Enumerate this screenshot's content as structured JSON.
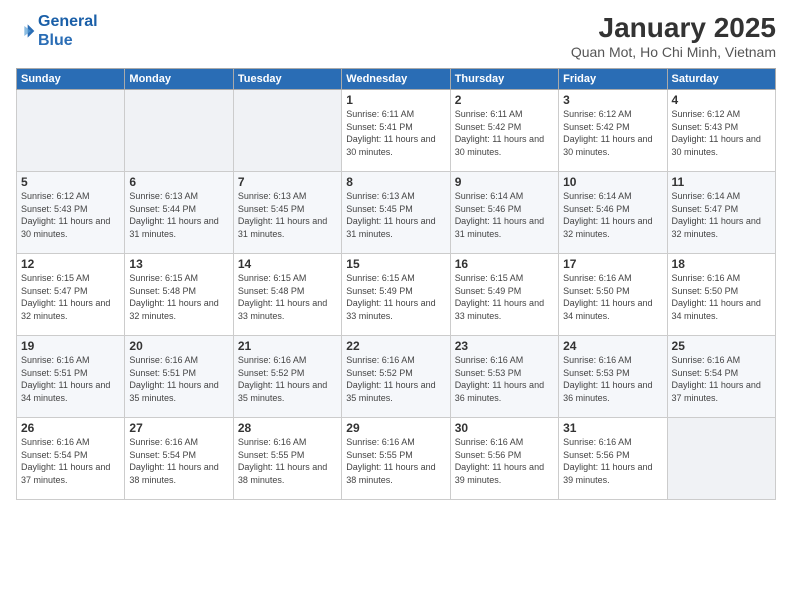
{
  "logo": {
    "line1": "General",
    "line2": "Blue"
  },
  "title": "January 2025",
  "subtitle": "Quan Mot, Ho Chi Minh, Vietnam",
  "weekdays": [
    "Sunday",
    "Monday",
    "Tuesday",
    "Wednesday",
    "Thursday",
    "Friday",
    "Saturday"
  ],
  "weeks": [
    [
      {
        "day": "",
        "info": ""
      },
      {
        "day": "",
        "info": ""
      },
      {
        "day": "",
        "info": ""
      },
      {
        "day": "1",
        "info": "Sunrise: 6:11 AM\nSunset: 5:41 PM\nDaylight: 11 hours\nand 30 minutes."
      },
      {
        "day": "2",
        "info": "Sunrise: 6:11 AM\nSunset: 5:42 PM\nDaylight: 11 hours\nand 30 minutes."
      },
      {
        "day": "3",
        "info": "Sunrise: 6:12 AM\nSunset: 5:42 PM\nDaylight: 11 hours\nand 30 minutes."
      },
      {
        "day": "4",
        "info": "Sunrise: 6:12 AM\nSunset: 5:43 PM\nDaylight: 11 hours\nand 30 minutes."
      }
    ],
    [
      {
        "day": "5",
        "info": "Sunrise: 6:12 AM\nSunset: 5:43 PM\nDaylight: 11 hours\nand 30 minutes."
      },
      {
        "day": "6",
        "info": "Sunrise: 6:13 AM\nSunset: 5:44 PM\nDaylight: 11 hours\nand 31 minutes."
      },
      {
        "day": "7",
        "info": "Sunrise: 6:13 AM\nSunset: 5:45 PM\nDaylight: 11 hours\nand 31 minutes."
      },
      {
        "day": "8",
        "info": "Sunrise: 6:13 AM\nSunset: 5:45 PM\nDaylight: 11 hours\nand 31 minutes."
      },
      {
        "day": "9",
        "info": "Sunrise: 6:14 AM\nSunset: 5:46 PM\nDaylight: 11 hours\nand 31 minutes."
      },
      {
        "day": "10",
        "info": "Sunrise: 6:14 AM\nSunset: 5:46 PM\nDaylight: 11 hours\nand 32 minutes."
      },
      {
        "day": "11",
        "info": "Sunrise: 6:14 AM\nSunset: 5:47 PM\nDaylight: 11 hours\nand 32 minutes."
      }
    ],
    [
      {
        "day": "12",
        "info": "Sunrise: 6:15 AM\nSunset: 5:47 PM\nDaylight: 11 hours\nand 32 minutes."
      },
      {
        "day": "13",
        "info": "Sunrise: 6:15 AM\nSunset: 5:48 PM\nDaylight: 11 hours\nand 32 minutes."
      },
      {
        "day": "14",
        "info": "Sunrise: 6:15 AM\nSunset: 5:48 PM\nDaylight: 11 hours\nand 33 minutes."
      },
      {
        "day": "15",
        "info": "Sunrise: 6:15 AM\nSunset: 5:49 PM\nDaylight: 11 hours\nand 33 minutes."
      },
      {
        "day": "16",
        "info": "Sunrise: 6:15 AM\nSunset: 5:49 PM\nDaylight: 11 hours\nand 33 minutes."
      },
      {
        "day": "17",
        "info": "Sunrise: 6:16 AM\nSunset: 5:50 PM\nDaylight: 11 hours\nand 34 minutes."
      },
      {
        "day": "18",
        "info": "Sunrise: 6:16 AM\nSunset: 5:50 PM\nDaylight: 11 hours\nand 34 minutes."
      }
    ],
    [
      {
        "day": "19",
        "info": "Sunrise: 6:16 AM\nSunset: 5:51 PM\nDaylight: 11 hours\nand 34 minutes."
      },
      {
        "day": "20",
        "info": "Sunrise: 6:16 AM\nSunset: 5:51 PM\nDaylight: 11 hours\nand 35 minutes."
      },
      {
        "day": "21",
        "info": "Sunrise: 6:16 AM\nSunset: 5:52 PM\nDaylight: 11 hours\nand 35 minutes."
      },
      {
        "day": "22",
        "info": "Sunrise: 6:16 AM\nSunset: 5:52 PM\nDaylight: 11 hours\nand 35 minutes."
      },
      {
        "day": "23",
        "info": "Sunrise: 6:16 AM\nSunset: 5:53 PM\nDaylight: 11 hours\nand 36 minutes."
      },
      {
        "day": "24",
        "info": "Sunrise: 6:16 AM\nSunset: 5:53 PM\nDaylight: 11 hours\nand 36 minutes."
      },
      {
        "day": "25",
        "info": "Sunrise: 6:16 AM\nSunset: 5:54 PM\nDaylight: 11 hours\nand 37 minutes."
      }
    ],
    [
      {
        "day": "26",
        "info": "Sunrise: 6:16 AM\nSunset: 5:54 PM\nDaylight: 11 hours\nand 37 minutes."
      },
      {
        "day": "27",
        "info": "Sunrise: 6:16 AM\nSunset: 5:54 PM\nDaylight: 11 hours\nand 38 minutes."
      },
      {
        "day": "28",
        "info": "Sunrise: 6:16 AM\nSunset: 5:55 PM\nDaylight: 11 hours\nand 38 minutes."
      },
      {
        "day": "29",
        "info": "Sunrise: 6:16 AM\nSunset: 5:55 PM\nDaylight: 11 hours\nand 38 minutes."
      },
      {
        "day": "30",
        "info": "Sunrise: 6:16 AM\nSunset: 5:56 PM\nDaylight: 11 hours\nand 39 minutes."
      },
      {
        "day": "31",
        "info": "Sunrise: 6:16 AM\nSunset: 5:56 PM\nDaylight: 11 hours\nand 39 minutes."
      },
      {
        "day": "",
        "info": ""
      }
    ]
  ]
}
